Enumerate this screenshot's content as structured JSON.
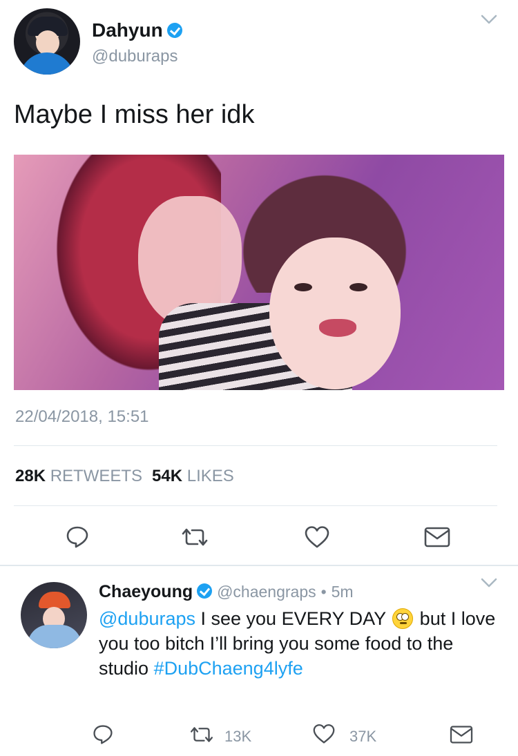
{
  "main_tweet": {
    "author_name": "Dahyun",
    "author_handle": "@duburaps",
    "text": "Maybe I miss her idk",
    "timestamp": "22/04/2018, 15:51",
    "retweets_count": "28K",
    "retweets_label": "RETWEETS",
    "likes_count": "54K",
    "likes_label": "LIKES",
    "verified": true
  },
  "reply_tweet": {
    "author_name": "Chaeyoung",
    "author_handle": "@chaengraps",
    "separator": "•",
    "time_ago": "5m",
    "mention": "@duburaps",
    "text_part1": " I see you EVERY DAY ",
    "text_part2": " but I love you too bitch I’ll bring you some food to the studio ",
    "hashtag": "#DubChaeng4lyfe",
    "emoji": "face-with-rolling-eyes",
    "retweet_count": "13K",
    "like_count": "37K",
    "verified": true
  },
  "colors": {
    "accent": "#1da1f2",
    "text": "#14171a",
    "muted": "#8a96a3",
    "divider": "#e1e8ed"
  },
  "icons": [
    "chevron-down-icon",
    "verified-badge-icon",
    "reply-icon",
    "retweet-icon",
    "like-icon",
    "direct-message-icon"
  ]
}
